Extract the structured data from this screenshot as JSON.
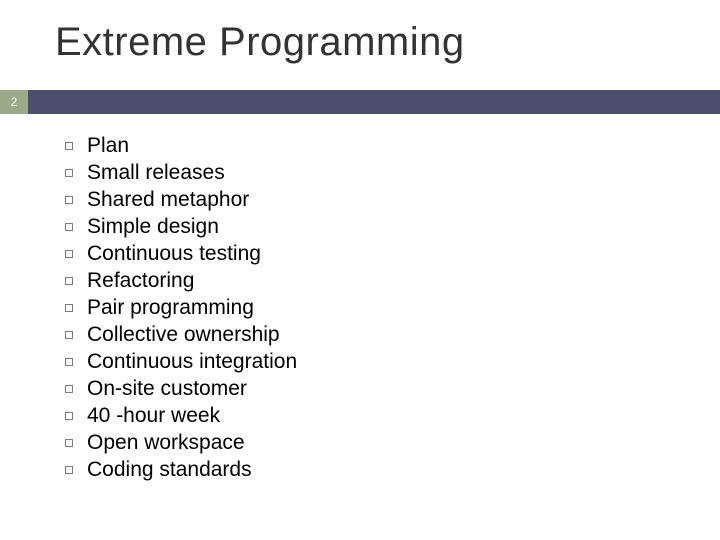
{
  "title": "Extreme Programming",
  "page_number": "2",
  "colors": {
    "bar": "#4b4f6b",
    "page_box": "#9aa987"
  },
  "bullets": [
    "Plan",
    "Small releases",
    "Shared metaphor",
    "Simple design",
    "Continuous testing",
    "Refactoring",
    "Pair programming",
    "Collective ownership",
    "Continuous integration",
    "On-site customer",
    "40 -hour week",
    "Open workspace",
    "Coding standards"
  ]
}
